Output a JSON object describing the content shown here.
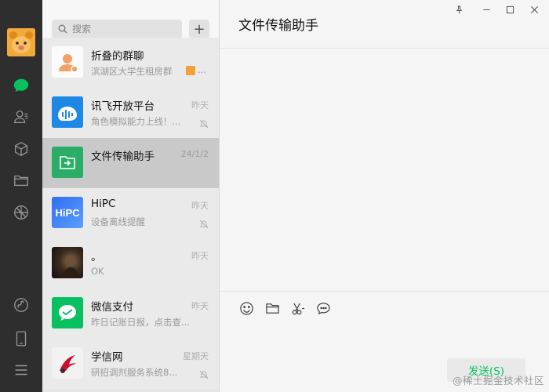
{
  "window": {
    "title": "文件传输助手",
    "controls": [
      "pin-icon",
      "minimize-icon",
      "maximize-icon",
      "close-icon"
    ]
  },
  "rail": {
    "icons": [
      "chat-icon",
      "contacts-icon",
      "collections-icon",
      "folder-icon",
      "moments-icon",
      "mini-programs-icon",
      "phone-icon",
      "menu-icon"
    ],
    "active": "chat-icon",
    "accent": "#07c160"
  },
  "search": {
    "placeholder": "搜索",
    "add_label": "+"
  },
  "chats": [
    {
      "name": "折叠的群聊",
      "preview": "滨湖区大学生租房群",
      "time": "",
      "muted": false,
      "avatar": "folded-group-avatar",
      "avatar_color": "#f2a066"
    },
    {
      "name": "讯飞开放平台",
      "preview": "角色模拟能力上线！...",
      "time": "昨天",
      "muted": true,
      "avatar": "xunfei-avatar",
      "avatar_color": "#1e88e5"
    },
    {
      "name": "文件传输助手",
      "preview": "",
      "time": "24/1/2",
      "muted": false,
      "avatar": "file-transfer-avatar",
      "avatar_color": "#2aae67",
      "selected": true
    },
    {
      "name": "HiPC",
      "preview": "设备离线提醒",
      "time": "昨天",
      "muted": true,
      "avatar": "hipc-avatar",
      "avatar_color": "#3d7bf0",
      "avatar_text": "HiPC"
    },
    {
      "name": "。",
      "preview": "OK",
      "time": "昨天",
      "muted": false,
      "avatar": "photo-avatar",
      "avatar_color": "#2b2119"
    },
    {
      "name": "微信支付",
      "preview": "昨日记账日报，点击查...",
      "time": "昨天",
      "muted": false,
      "avatar": "wechat-pay-avatar",
      "avatar_color": "#07c160"
    },
    {
      "name": "学信网",
      "preview": "研招调剂服务系统8...",
      "time": "星期天",
      "muted": true,
      "avatar": "xuexin-avatar",
      "avatar_color": "#f0f0f0"
    }
  ],
  "composer": {
    "tools": [
      "emoji-icon",
      "folder-icon",
      "scissors-icon",
      "chat-bubble-icon"
    ],
    "send_label": "发送(S)"
  },
  "watermark": "@稀土掘金技术社区"
}
